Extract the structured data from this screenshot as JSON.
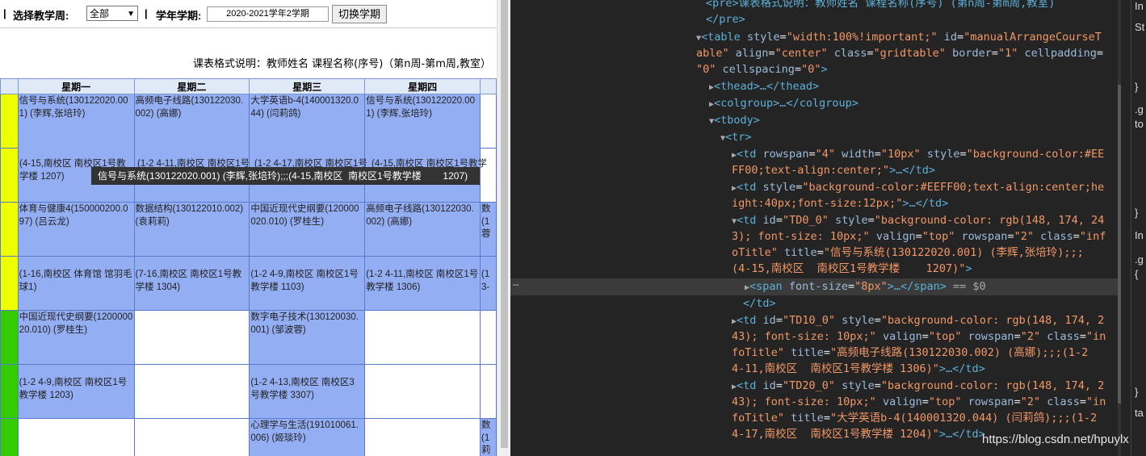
{
  "toolbar": {
    "leading_sep": "|",
    "week_label": "选择教学周:",
    "week_value": "全部",
    "sep2": "|",
    "term_label": "学年学期:",
    "term_value": "2020-2021学年2学期",
    "switch_btn": "切换学期"
  },
  "format_note": "课表格式说明：教师姓名 课程名称(序号)（第n周-第m周,教室）",
  "days": [
    "星期一",
    "星期二",
    "星期三",
    "星期四"
  ],
  "schedule": {
    "r0c1": "信号与系统(130122020.001) (李辉,张培玲)",
    "r0c1b": "(4-15,南校区 南校区1号教学楼 1207)",
    "r0c2": "高频电子线路(130122030.002) (高娜)",
    "r0c2b": "(1-2 4-11,南校区 南校区1号",
    "r0c3": "大学英语b-4(140001320.044) (闫莉鸽)",
    "r0c3b": "(1-2 4-17,南校区 南校区1号",
    "r0c4": "信号与系统(130122020.001) (李辉,张培玲)",
    "r0c4b": "(4-15,南校区 南校区1号教学楼",
    "r1c1": "体育与健康4(150000200.097) (吕云龙)",
    "r1c1b": "(1-16,南校区 体育馆 馆羽毛球1)",
    "r1c2": "数据结构(130122010.002) (袁莉莉)",
    "r1c2b": "(7-16,南校区 南校区1号教学楼 1304)",
    "r1c3": "中国近现代史纲要(120000020.010) (罗桂生)",
    "r1c3b": "(1-2 4-9,南校区 南校区1号教学楼 1103)",
    "r1c4": "高频电子线路(130122030.002) (高娜)",
    "r1c4b": "(1-2 4-11,南校区 南校区1号教学楼 1306)",
    "r1c5": "数(1蓉",
    "r1c5b": "(1 3-",
    "r2c1": "中国近现代史纲要(120000020.010) (罗桂生)",
    "r2c1b": "(1-2 4-9,南校区 南校区1号教学楼 1203)",
    "r2c3": "数字电子技术(130120030.001) (邹波蓉)",
    "r2c3b": "(1-2 4-13,南校区 南校区3号教学楼 3307)",
    "r3c3": "心理学与生活(191010061.006) (姬琰玲)",
    "r3c5": "数(1莉"
  },
  "tooltip": "信号与系统(130122020.001) (李辉,张培玲);;;(4-15,南校区  南校区1号教学楼        1207)",
  "devtools": {
    "l0": "<pre>课表格式说明：教师姓名 课程名称(序号) (第n周-第m周,教室)",
    "l1": "</pre>",
    "l2_tag": "<table ",
    "l2_a1": "style",
    "l2_v1": "\"width:100%!important;\"",
    "l2_a2": "id",
    "l2_v2": "\"manualArrangeCourseT",
    "l3_v2": "able\"",
    "l3_a3": "align",
    "l3_v3": "\"center\"",
    "l3_a4": "class",
    "l3_v4": "\"gridtable\"",
    "l3_a5": "border",
    "l3_v5": "\"1\"",
    "l3_a6": "cellpadding",
    "l4_v6": "\"0\"",
    "l4_a7": "cellspacing",
    "l4_v7": "\"0\"",
    "thead": "<thead>…</thead>",
    "colgroup": "<colgroup>…</colgroup>",
    "tbody": "<tbody>",
    "tr": "<tr>",
    "td1_a": "rowspan",
    "td1_v": "\"4\"",
    "td1_a2": "width",
    "td1_v2": "\"10px\"",
    "td1_a3": "style",
    "td1_v3": "\"background-color:#EE",
    "td1_l2": "FF00;text-align:center;\"",
    "td1_end": ">…</td>",
    "td2_v": "\"background-color:#EEFF00;text-align:center;he",
    "td2_l2": "ight:40px;font-size:12px;\"",
    "td3_id": "\"TD0_0\"",
    "td3_style": "\"background-color: rgb(148, 174, 24",
    "td3_l2a": "3); font-size: 10px;\"",
    "td3_valign": "\"top\"",
    "td3_rowspan": "\"2\"",
    "td3_class": "\"inf",
    "td3_l3a": "oTitle\"",
    "td3_title": "\"信号与系统(130122020.001) (李辉,张培玲);;;",
    "td3_l4": "(4-15,南校区  南校区1号教学楼    1207)\"",
    "span_tag": "<span ",
    "span_attr": "font-size",
    "span_val": "\"8px\"",
    "span_rest": ">…</span>",
    "eq": " == $0",
    "td_close": "</td>",
    "td4_id": "\"TD10_0\"",
    "td4_style": "\"background-color: rgb(148, 174, 2",
    "td4_l2": "43); font-size: 10px;\"",
    "td4_class": "\"in",
    "td4_l3": "foTitle\"",
    "td4_title": "\"高频电子线路(130122030.002) (高娜);;;(1-2",
    "td4_l4": "4-11,南校区  南校区1号教学楼 1306)\"",
    "td5_id": "\"TD20_0\"",
    "td5_title": "\"大学英语b-4(140001320.044) (闫莉鸽);;;(1-2",
    "td5_l4": "4-17,南校区  南校区1号教学楼 1204)\"",
    "td5_end": ">…</td>"
  },
  "styles_pane": {
    "t1": "In",
    "t2": "St",
    "t3": "}",
    "t4": ".g",
    "t5": "to",
    "t6": "}",
    "t7": "In",
    "t8": ".g",
    "t9": "{",
    "t10": "}",
    "t11": "ta"
  },
  "watermark": "https://blog.csdn.net/hpuylx"
}
